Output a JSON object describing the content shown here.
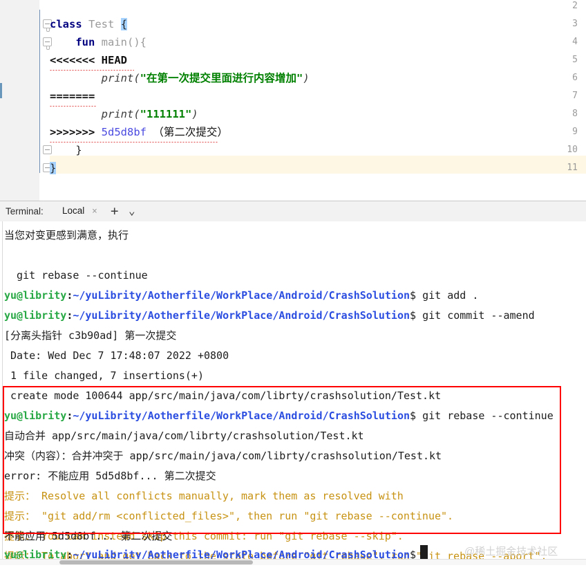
{
  "editor": {
    "lines": [
      {
        "number": "2",
        "text": ""
      },
      {
        "number": "3",
        "text": "class Test {"
      },
      {
        "number": "4",
        "text": "    fun main(){"
      },
      {
        "number": "5",
        "text": "<<<<<<< HEAD"
      },
      {
        "number": "6",
        "text": "        print(\"在第一次提交里面进行内容增加\")"
      },
      {
        "number": "7",
        "text": "======="
      },
      {
        "number": "8",
        "text": "        print(\"111111\")"
      },
      {
        "number": "9",
        "text": ">>>>>>> 5d5d8bf （第二次提交）"
      },
      {
        "number": "10",
        "text": "    }"
      },
      {
        "number": "11",
        "text": "}"
      }
    ],
    "tokens": {
      "kw_class": "class",
      "type_name": "Test",
      "brace_open": "{",
      "kw_fun": "fun",
      "fn_main": "main(){",
      "conflict_head": "<<<<<<< HEAD",
      "print_call": "print(",
      "string_cn": "\"在第一次提交里面进行内容增加\"",
      "paren_close": ")",
      "conflict_sep": "=======",
      "string_num": "\"111111\"",
      "conflict_tail": ">>>>>>>",
      "commit_hash": "5d5d8bf",
      "commit_note": "（第二次提交）",
      "brace_close_inner": "}",
      "brace_close_outer": "}"
    }
  },
  "terminal_panel": {
    "label": "Terminal:",
    "tab_name": "Local",
    "close_icon": "×",
    "add_icon": "+",
    "chevron_icon": "⌄"
  },
  "terminal": {
    "prompt": {
      "user": "yu@librity",
      "colon": ":",
      "path": "~/yuLibrity/Aotherfile/WorkPlace/Android/CrashSolution",
      "dollar": "$"
    },
    "lines": [
      {
        "type": "plain",
        "text": "当您对变更感到满意，执行"
      },
      {
        "type": "plain",
        "text": ""
      },
      {
        "type": "plain",
        "text": "  git rebase --continue"
      },
      {
        "type": "prompt",
        "command": " git add ."
      },
      {
        "type": "prompt",
        "command": " git commit --amend"
      },
      {
        "type": "plain",
        "text": "[分离头指针 c3b90ad] 第一次提交"
      },
      {
        "type": "plain",
        "text": " Date: Wed Dec 7 17:48:07 2022 +0800"
      },
      {
        "type": "plain",
        "text": " 1 file changed, 7 insertions(+)"
      },
      {
        "type": "plain",
        "text": " create mode 100644 app/src/main/java/com/librty/crashsolution/Test.kt"
      },
      {
        "type": "prompt",
        "command": " git rebase --continue"
      },
      {
        "type": "plain",
        "text": "自动合并 app/src/main/java/com/librty/crashsolution/Test.kt"
      },
      {
        "type": "plain",
        "text": "冲突（内容）：合并冲突于 app/src/main/java/com/librty/crashsolution/Test.kt"
      },
      {
        "type": "plain",
        "text": "error: 不能应用 5d5d8bf... 第二次提交"
      },
      {
        "type": "hint",
        "text": "提示： Resolve all conflicts manually, mark them as resolved with"
      },
      {
        "type": "hint",
        "text": "提示： \"git add/rm <conflicted_files>\", then run \"git rebase --continue\"."
      },
      {
        "type": "hint",
        "text": "提示： You can instead skip this commit: run \"git rebase --skip\"."
      },
      {
        "type": "hint",
        "text": "提示： To abort and get back to the state before \"git rebase\", run \"git rebase --abort\"."
      },
      {
        "type": "plain",
        "text": "不能应用 5d5d8bf... 第二次提交"
      },
      {
        "type": "prompt",
        "command": " "
      }
    ],
    "watermark": "@稀土掘金技术社区",
    "highlight_box_color": "#ff0000"
  }
}
